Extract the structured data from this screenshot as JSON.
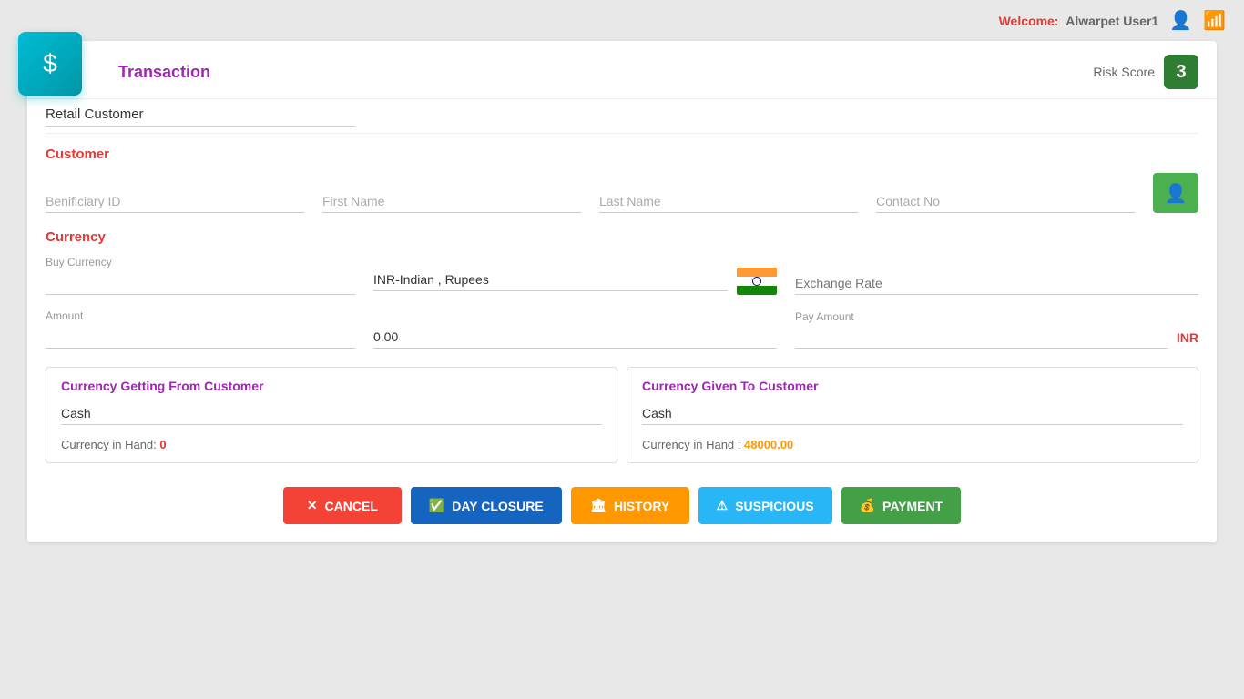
{
  "topbar": {
    "welcome_label": "Welcome:",
    "user_name": "Alwarpet User1"
  },
  "header": {
    "transaction_label": "Transaction",
    "risk_score_label": "Risk Score",
    "risk_score_value": "3",
    "dollar_icon": "$"
  },
  "retail_customer": {
    "label": "Retail Customer"
  },
  "customer_section": {
    "title": "Customer",
    "beneficiary_id_placeholder": "Benificiary ID",
    "first_name_placeholder": "First Name",
    "last_name_placeholder": "Last Name",
    "contact_no_placeholder": "Contact No",
    "add_btn_icon": "👤"
  },
  "currency_section": {
    "title": "Currency",
    "buy_currency_label": "Buy Currency",
    "buy_currency_placeholder": "",
    "selected_currency": "INR-Indian , Rupees",
    "exchange_rate_placeholder": "Exchange Rate",
    "amount_label": "Amount",
    "amount_value": "0.00",
    "pay_amount_label": "Pay Amount",
    "pay_amount_currency": "INR"
  },
  "currency_getting": {
    "title": "Currency Getting From Customer",
    "cash_label": "Cash",
    "currency_in_hand_label": "Currency in Hand:",
    "currency_in_hand_value": "0",
    "currency_in_hand_color": "red"
  },
  "currency_given": {
    "title": "Currency Given To Customer",
    "cash_label": "Cash",
    "currency_in_hand_label": "Currency in Hand :",
    "currency_in_hand_value": "48000.00",
    "currency_in_hand_color": "orange"
  },
  "buttons": {
    "cancel": "CANCEL",
    "day_closure": "DAY CLOSURE",
    "history": "HISTORY",
    "suspicious": "SUSPICIOUS",
    "payment": "PAYMENT"
  }
}
